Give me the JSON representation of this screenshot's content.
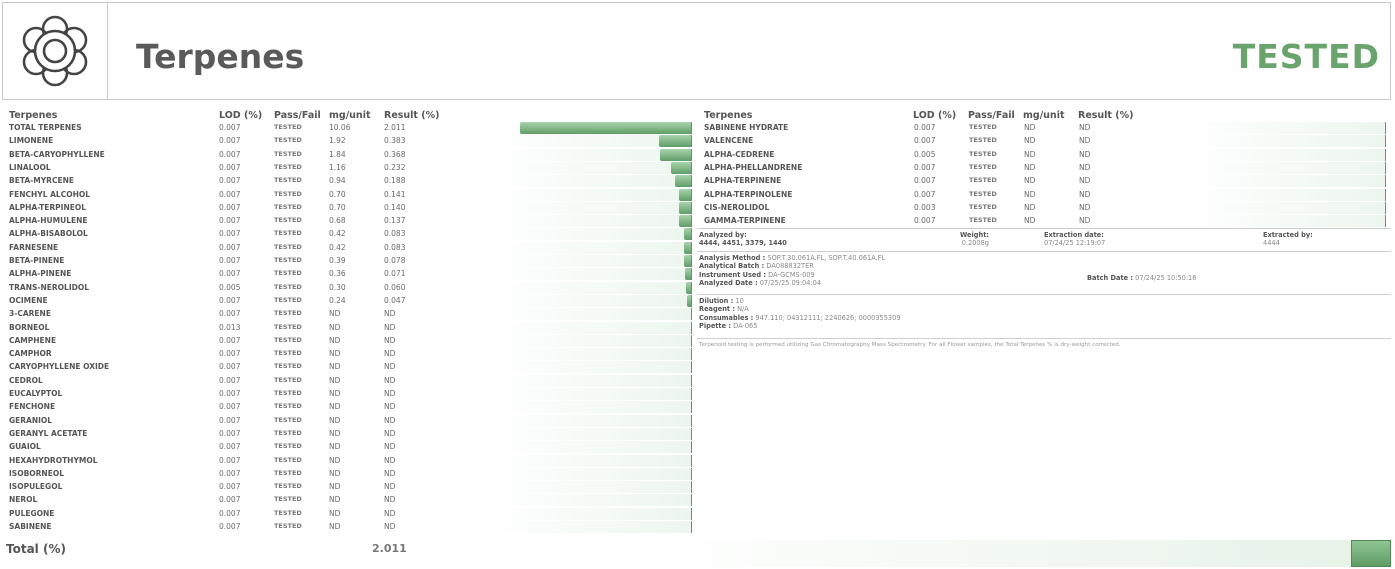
{
  "header": {
    "title": "Terpenes",
    "status": "TESTED",
    "logo_icon": "flower-icon",
    "status_color": "#6aa46d"
  },
  "columns": {
    "name": "Terpenes",
    "lod": "LOD (%)",
    "passfail": "Pass/Fail",
    "mg": "mg/unit",
    "result": "Result (%)"
  },
  "left_rows": [
    {
      "name": "TOTAL TERPENES",
      "lod": "0.007",
      "pf": "TESTED",
      "mg": "10.06",
      "result": "2.011",
      "level": 1.0
    },
    {
      "name": "LIMONENE",
      "lod": "0.007",
      "pf": "TESTED",
      "mg": "1.92",
      "result": "0.383",
      "level": 0.19
    },
    {
      "name": "BETA-CARYOPHYLLENE",
      "lod": "0.007",
      "pf": "TESTED",
      "mg": "1.84",
      "result": "0.368",
      "level": 0.18
    },
    {
      "name": "LINALOOL",
      "lod": "0.007",
      "pf": "TESTED",
      "mg": "1.16",
      "result": "0.232",
      "level": 0.115
    },
    {
      "name": "BETA-MYRCENE",
      "lod": "0.007",
      "pf": "TESTED",
      "mg": "0.94",
      "result": "0.188",
      "level": 0.093
    },
    {
      "name": "FENCHYL ALCOHOL",
      "lod": "0.007",
      "pf": "TESTED",
      "mg": "0.70",
      "result": "0.141",
      "level": 0.07
    },
    {
      "name": "ALPHA-TERPINEOL",
      "lod": "0.007",
      "pf": "TESTED",
      "mg": "0.70",
      "result": "0.140",
      "level": 0.07
    },
    {
      "name": "ALPHA-HUMULENE",
      "lod": "0.007",
      "pf": "TESTED",
      "mg": "0.68",
      "result": "0.137",
      "level": 0.068
    },
    {
      "name": "ALPHA-BISABOLOL",
      "lod": "0.007",
      "pf": "TESTED",
      "mg": "0.42",
      "result": "0.083",
      "level": 0.041
    },
    {
      "name": "FARNESENE",
      "lod": "0.007",
      "pf": "TESTED",
      "mg": "0.42",
      "result": "0.083",
      "level": 0.041
    },
    {
      "name": "BETA-PINENE",
      "lod": "0.007",
      "pf": "TESTED",
      "mg": "0.39",
      "result": "0.078",
      "level": 0.039
    },
    {
      "name": "ALPHA-PINENE",
      "lod": "0.007",
      "pf": "TESTED",
      "mg": "0.36",
      "result": "0.071",
      "level": 0.035
    },
    {
      "name": "TRANS-NEROLIDOL",
      "lod": "0.005",
      "pf": "TESTED",
      "mg": "0.30",
      "result": "0.060",
      "level": 0.03
    },
    {
      "name": "OCIMENE",
      "lod": "0.007",
      "pf": "TESTED",
      "mg": "0.24",
      "result": "0.047",
      "level": 0.023
    },
    {
      "name": "3-CARENE",
      "lod": "0.007",
      "pf": "TESTED",
      "mg": "ND",
      "result": "ND",
      "level": 0
    },
    {
      "name": "BORNEOL",
      "lod": "0.013",
      "pf": "TESTED",
      "mg": "ND",
      "result": "ND",
      "level": 0
    },
    {
      "name": "CAMPHENE",
      "lod": "0.007",
      "pf": "TESTED",
      "mg": "ND",
      "result": "ND",
      "level": 0
    },
    {
      "name": "CAMPHOR",
      "lod": "0.007",
      "pf": "TESTED",
      "mg": "ND",
      "result": "ND",
      "level": 0
    },
    {
      "name": "CARYOPHYLLENE OXIDE",
      "lod": "0.007",
      "pf": "TESTED",
      "mg": "ND",
      "result": "ND",
      "level": 0
    },
    {
      "name": "CEDROL",
      "lod": "0.007",
      "pf": "TESTED",
      "mg": "ND",
      "result": "ND",
      "level": 0
    },
    {
      "name": "EUCALYPTOL",
      "lod": "0.007",
      "pf": "TESTED",
      "mg": "ND",
      "result": "ND",
      "level": 0
    },
    {
      "name": "FENCHONE",
      "lod": "0.007",
      "pf": "TESTED",
      "mg": "ND",
      "result": "ND",
      "level": 0
    },
    {
      "name": "GERANIOL",
      "lod": "0.007",
      "pf": "TESTED",
      "mg": "ND",
      "result": "ND",
      "level": 0
    },
    {
      "name": "GERANYL ACETATE",
      "lod": "0.007",
      "pf": "TESTED",
      "mg": "ND",
      "result": "ND",
      "level": 0
    },
    {
      "name": "GUAIOL",
      "lod": "0.007",
      "pf": "TESTED",
      "mg": "ND",
      "result": "ND",
      "level": 0
    },
    {
      "name": "HEXAHYDROTHYMOL",
      "lod": "0.007",
      "pf": "TESTED",
      "mg": "ND",
      "result": "ND",
      "level": 0
    },
    {
      "name": "ISOBORNEOL",
      "lod": "0.007",
      "pf": "TESTED",
      "mg": "ND",
      "result": "ND",
      "level": 0
    },
    {
      "name": "ISOPULEGOL",
      "lod": "0.007",
      "pf": "TESTED",
      "mg": "ND",
      "result": "ND",
      "level": 0
    },
    {
      "name": "NEROL",
      "lod": "0.007",
      "pf": "TESTED",
      "mg": "ND",
      "result": "ND",
      "level": 0
    },
    {
      "name": "PULEGONE",
      "lod": "0.007",
      "pf": "TESTED",
      "mg": "ND",
      "result": "ND",
      "level": 0
    },
    {
      "name": "SABINENE",
      "lod": "0.007",
      "pf": "TESTED",
      "mg": "ND",
      "result": "ND",
      "level": 0
    }
  ],
  "right_rows": [
    {
      "name": "SABINENE HYDRATE",
      "lod": "0.007",
      "pf": "TESTED",
      "mg": "ND",
      "result": "ND",
      "level": 0
    },
    {
      "name": "VALENCENE",
      "lod": "0.007",
      "pf": "TESTED",
      "mg": "ND",
      "result": "ND",
      "level": 0
    },
    {
      "name": "ALPHA-CEDRENE",
      "lod": "0.005",
      "pf": "TESTED",
      "mg": "ND",
      "result": "ND",
      "level": 0
    },
    {
      "name": "ALPHA-PHELLANDRENE",
      "lod": "0.007",
      "pf": "TESTED",
      "mg": "ND",
      "result": "ND",
      "level": 0
    },
    {
      "name": "ALPHA-TERPINENE",
      "lod": "0.007",
      "pf": "TESTED",
      "mg": "ND",
      "result": "ND",
      "level": 0
    },
    {
      "name": "ALPHA-TERPINOLENE",
      "lod": "0.007",
      "pf": "TESTED",
      "mg": "ND",
      "result": "ND",
      "level": 0
    },
    {
      "name": "CIS-NEROLIDOL",
      "lod": "0.003",
      "pf": "TESTED",
      "mg": "ND",
      "result": "ND",
      "level": 0
    },
    {
      "name": "GAMMA-TERPINENE",
      "lod": "0.007",
      "pf": "TESTED",
      "mg": "ND",
      "result": "ND",
      "level": 0
    }
  ],
  "info": {
    "analyzed_by_label": "Analyzed by:",
    "analyzed_by": "4444, 4451, 3379, 1440",
    "weight_label": "Weight:",
    "weight": "0.2008g",
    "extraction_date_label": "Extraction date:",
    "extraction_date": "07/24/25 12:19:07",
    "extracted_by_label": "Extracted by:",
    "extracted_by": "4444",
    "analysis_method_label": "Analysis Method :",
    "analysis_method": "SOP.T.30.061A.FL, SOP.T.40.061A.FL",
    "analytical_batch_label": "Analytical Batch :",
    "analytical_batch": "DA088832TER",
    "instrument_label": "Instrument Used :",
    "instrument": "DA-GCMS-009",
    "analyzed_date_label": "Analyzed Date :",
    "analyzed_date": "07/25/25 09:04:04",
    "batch_date_label": "Batch Date :",
    "batch_date": "07/24/25 10:50:16",
    "dilution_label": "Dilution :",
    "dilution": "10",
    "reagent_label": "Reagent :",
    "reagent": "N/A",
    "consumables_label": "Consumables :",
    "consumables": "947.110; 04312111; 2240626; 0000355309",
    "pipette_label": "Pipette :",
    "pipette": "DA-065",
    "note": "Terpenoid testing is performed utilizing Gas Chromatography Mass Spectrometry. For all Flower samples, the Total Terpenes % is dry-weight corrected."
  },
  "total": {
    "label": "Total (%)",
    "value": "2.011"
  }
}
